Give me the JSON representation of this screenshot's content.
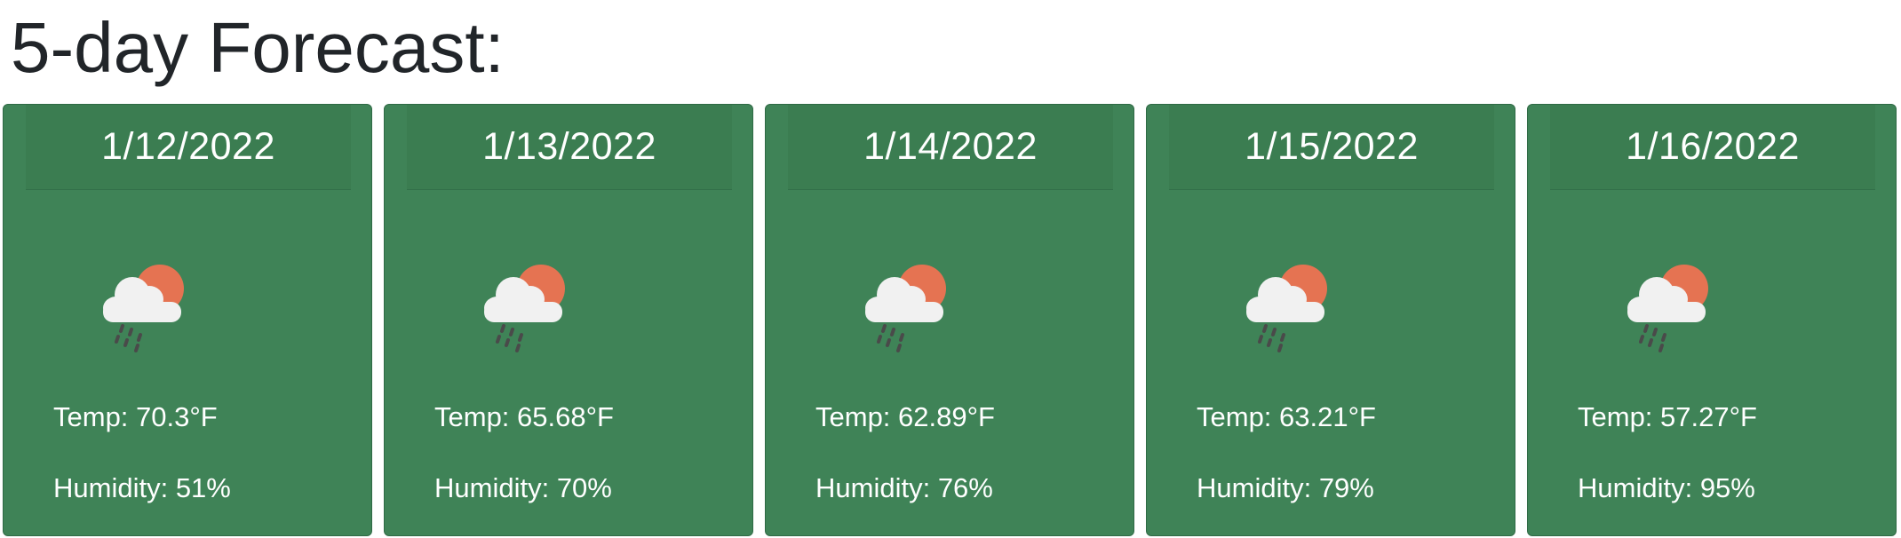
{
  "section": {
    "title": "5-day Forecast:"
  },
  "forecast": [
    {
      "date": "1/12/2022",
      "icon": "rain-cloud-sun-icon",
      "temp_label": "Temp: ",
      "temp": "70.3",
      "temp_unit": "°F",
      "humidity_label": "Humidity: ",
      "humidity": "51",
      "humidity_unit": "%"
    },
    {
      "date": "1/13/2022",
      "icon": "rain-cloud-sun-icon",
      "temp_label": "Temp: ",
      "temp": "65.68",
      "temp_unit": "°F",
      "humidity_label": "Humidity: ",
      "humidity": "70",
      "humidity_unit": "%"
    },
    {
      "date": "1/14/2022",
      "icon": "rain-cloud-sun-icon",
      "temp_label": "Temp: ",
      "temp": "62.89",
      "temp_unit": "°F",
      "humidity_label": "Humidity: ",
      "humidity": "76",
      "humidity_unit": "%"
    },
    {
      "date": "1/15/2022",
      "icon": "rain-cloud-sun-icon",
      "temp_label": "Temp: ",
      "temp": "63.21",
      "temp_unit": "°F",
      "humidity_label": "Humidity: ",
      "humidity": "79",
      "humidity_unit": "%"
    },
    {
      "date": "1/16/2022",
      "icon": "rain-cloud-sun-icon",
      "temp_label": "Temp: ",
      "temp": "57.27",
      "temp_unit": "°F",
      "humidity_label": "Humidity: ",
      "humidity": "95",
      "humidity_unit": "%"
    }
  ],
  "colors": {
    "card_background": "#3f8357",
    "card_header": "#3b7d51",
    "sun": "#e57352",
    "cloud": "#f1f1f1",
    "rain": "#4a4a4a"
  }
}
